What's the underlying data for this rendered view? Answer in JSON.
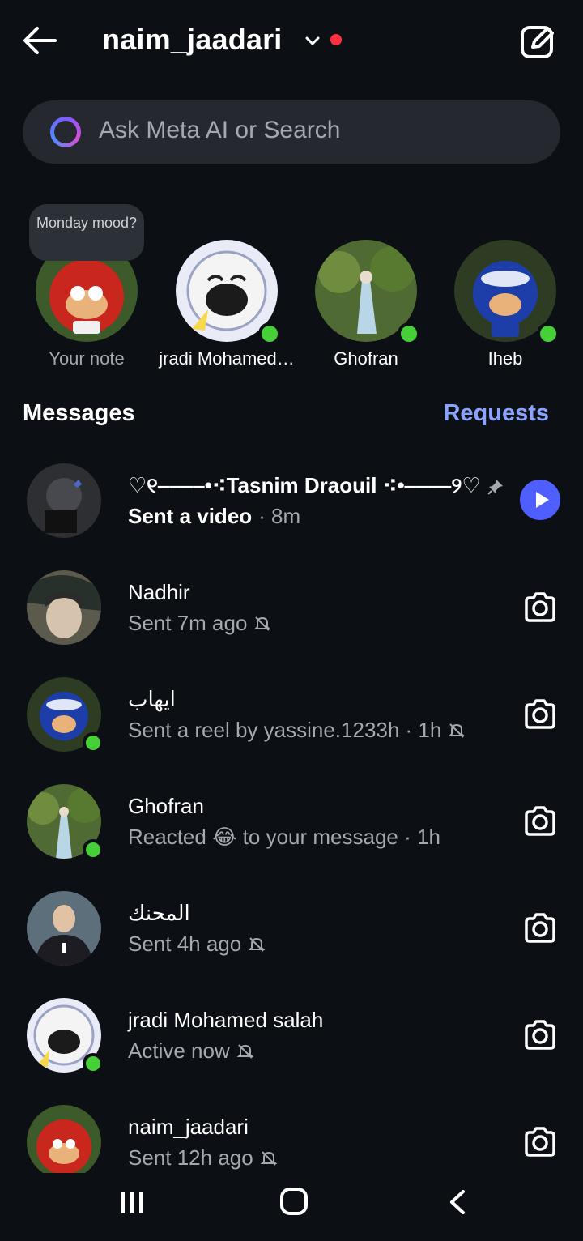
{
  "header": {
    "username": "naim_jaadari",
    "icons": {
      "back": "arrow-left-icon",
      "dropdown": "chevron-down-icon",
      "compose": "edit-icon"
    },
    "status_dot_color": "#ff3040"
  },
  "search": {
    "placeholder": "Ask Meta AI or Search"
  },
  "notes": {
    "bubble_text": "Monday mood?",
    "items": [
      {
        "label": "Your note",
        "online": false
      },
      {
        "label": "jradi Mohamed…",
        "online": true
      },
      {
        "label": "Ghofran",
        "online": true
      },
      {
        "label": "Iheb",
        "online": true
      }
    ]
  },
  "messages_section": {
    "title": "Messages",
    "requests_label": "Requests"
  },
  "threads": [
    {
      "name": "♡୧‒‒‒‒•⁖Tasnim Draouil ⁖•‒‒‒‒୨♡",
      "status_action": "Sent a video",
      "status_time": " · 8m",
      "pinned": true,
      "action": "play"
    },
    {
      "name": "Nadhir",
      "status": "Sent 7m ago",
      "muted": true,
      "action": "camera"
    },
    {
      "name": "ايهاب",
      "status": "Sent a reel by yassine.1233h · 1h",
      "muted": true,
      "online": true,
      "action": "camera"
    },
    {
      "name": "Ghofran",
      "status": "Reacted 😂 to your message · 1h",
      "online": true,
      "action": "camera"
    },
    {
      "name": "المحنك",
      "status": "Sent 4h ago",
      "muted": true,
      "action": "camera"
    },
    {
      "name": "jradi Mohamed salah",
      "status": "Active now",
      "muted": true,
      "online": true,
      "action": "camera"
    },
    {
      "name": "naim_jaadari",
      "status": "Sent 12h ago",
      "muted": true,
      "action": "camera"
    }
  ],
  "colors": {
    "background": "#0c0f14",
    "accent": "#8aa3ff",
    "online": "#47cf3a",
    "play": "#4f5fff"
  }
}
